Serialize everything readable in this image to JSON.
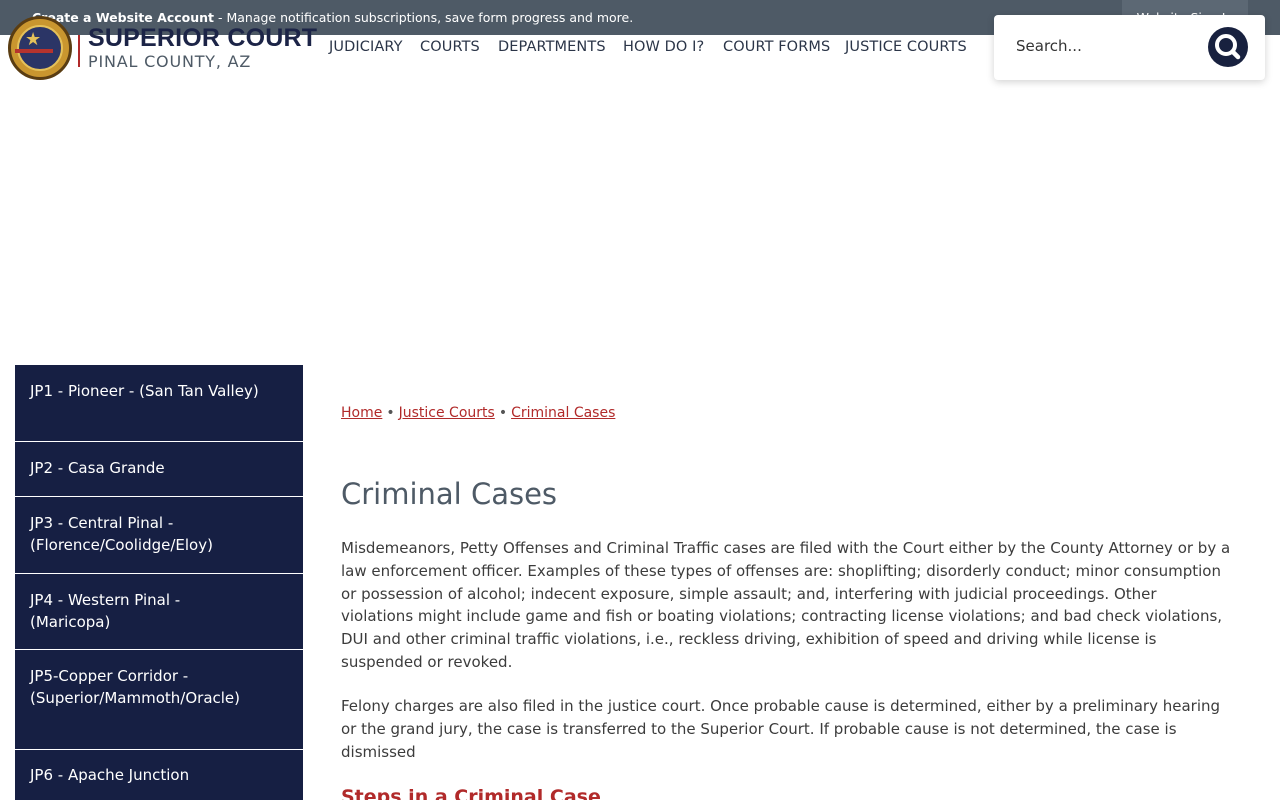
{
  "topbar": {
    "create_account_label": "Create a Website Account",
    "create_account_text": " - Manage notification subscriptions, save form progress and more.",
    "sign_in_label": "Website Sign In"
  },
  "header": {
    "logo_title": "SUPERIOR COURT",
    "logo_subtitle": "PINAL COUNTY, AZ",
    "nav": [
      "JUDICIARY",
      "COURTS",
      "DEPARTMENTS",
      "HOW DO I?",
      "COURT FORMS",
      "JUSTICE COURTS"
    ],
    "search_placeholder": "Search..."
  },
  "sidebar": {
    "items": [
      {
        "label": "JP1 - Pioneer  - (San Tan Valley)"
      },
      {
        "label": "JP2 - Casa Grande"
      },
      {
        "label": "JP3 - Central Pinal - (Florence/Coolidge/Eloy)"
      },
      {
        "label": "JP4  - Western Pinal  - (Maricopa)"
      },
      {
        "label": "JP5-Copper Corridor - (Superior/Mammoth/Oracle)"
      },
      {
        "label": "JP6 - Apache Junction"
      }
    ]
  },
  "breadcrumb": {
    "home": "Home",
    "justice_courts": "Justice Courts",
    "current": "Criminal Cases",
    "separator": "•"
  },
  "main": {
    "title": "Criminal Cases",
    "paragraph_1": "Misdemeanors, Petty Offenses and Criminal Traffic cases are filed with the Court either by the County Attorney or by a law enforcement officer. Examples of these types of offenses are: shoplifting; disorderly conduct; minor consumption or possession of alcohol; indecent exposure, simple assault; and, interfering with judicial proceedings. Other violations might include game and fish or boating violations; contracting license violations; and bad check violations, DUI and other criminal traffic violations, i.e., reckless driving, exhibition of speed and driving while license is suspended or revoked.",
    "paragraph_2": "Felony charges are also filed in the justice court. Once probable cause is determined, either by a preliminary hearing or the grand jury, the case is transferred to the Superior Court. If probable cause is not determined, the case is dismissed",
    "section_heading": "Steps in a Criminal Case"
  },
  "colors": {
    "topbar": "#4e5a66",
    "navy": "#161f43",
    "accent_red": "#b12a2a"
  },
  "icons": [
    "court-seal-icon",
    "search-icon"
  ]
}
